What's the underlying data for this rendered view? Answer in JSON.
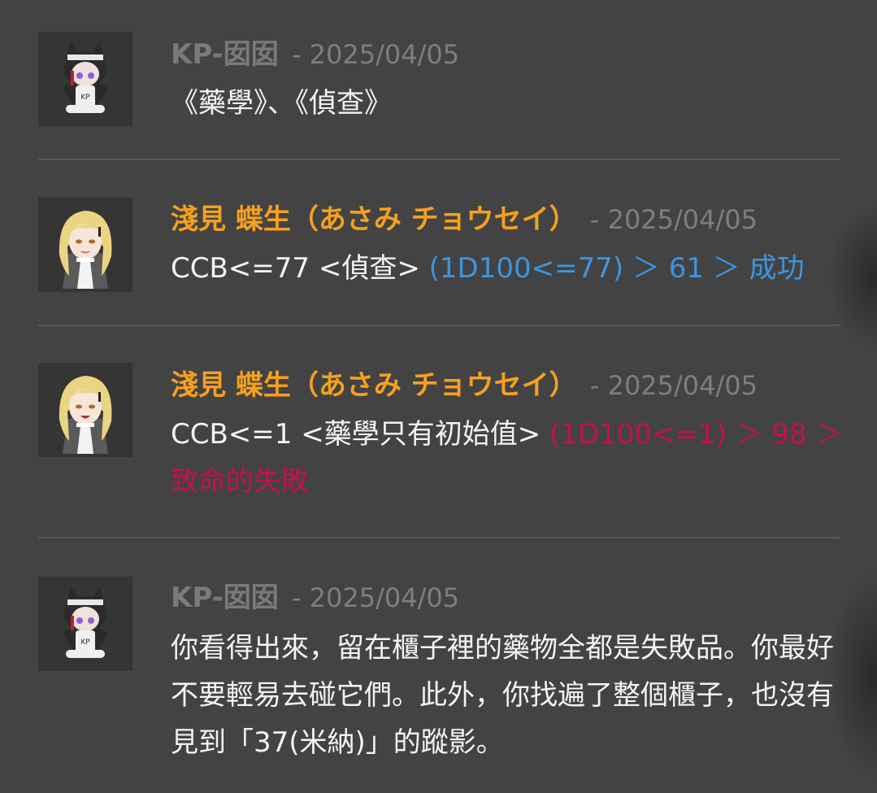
{
  "messages": [
    {
      "author": "KP-囡囡",
      "separator": " - ",
      "date": "2025/04/05",
      "avatar_icon": "kp-cat-girl-avatar",
      "text": "《藥學》、《偵查》"
    },
    {
      "author": "淺見 蝶生（あさみ チョウセイ）",
      "separator": " - ",
      "date": "2025/04/05",
      "avatar_icon": "blonde-character-avatar",
      "command": "CCB<=77 <偵查> ",
      "result": "(1D100<=77) ＞ 61 ＞ 成功"
    },
    {
      "author": "淺見 蝶生（あさみ チョウセイ）",
      "separator": " - ",
      "date": "2025/04/05",
      "avatar_icon": "blonde-character-avatar",
      "command": "CCB<=1 <藥學只有初始值> ",
      "result": "(1D100<=1) ＞ 98 ＞ 致命的失敗"
    },
    {
      "author": "KP-囡囡",
      "separator": " - ",
      "date": "2025/04/05",
      "avatar_icon": "kp-cat-girl-avatar",
      "text": "你看得出來，留在櫃子裡的藥物全都是失敗品。你最好不要輕易去碰它們。此外，你找遍了整個櫃子，也沒有見到「37(米納)」的蹤影。"
    }
  ],
  "colors": {
    "background": "#434343",
    "kp_name": "#7a7a7a",
    "player_name": "#f5a01f",
    "date": "#7e7e7e",
    "text": "#f3f3f3",
    "success": "#3b95e0",
    "fumble": "#c2114f",
    "divider": "#575757"
  }
}
